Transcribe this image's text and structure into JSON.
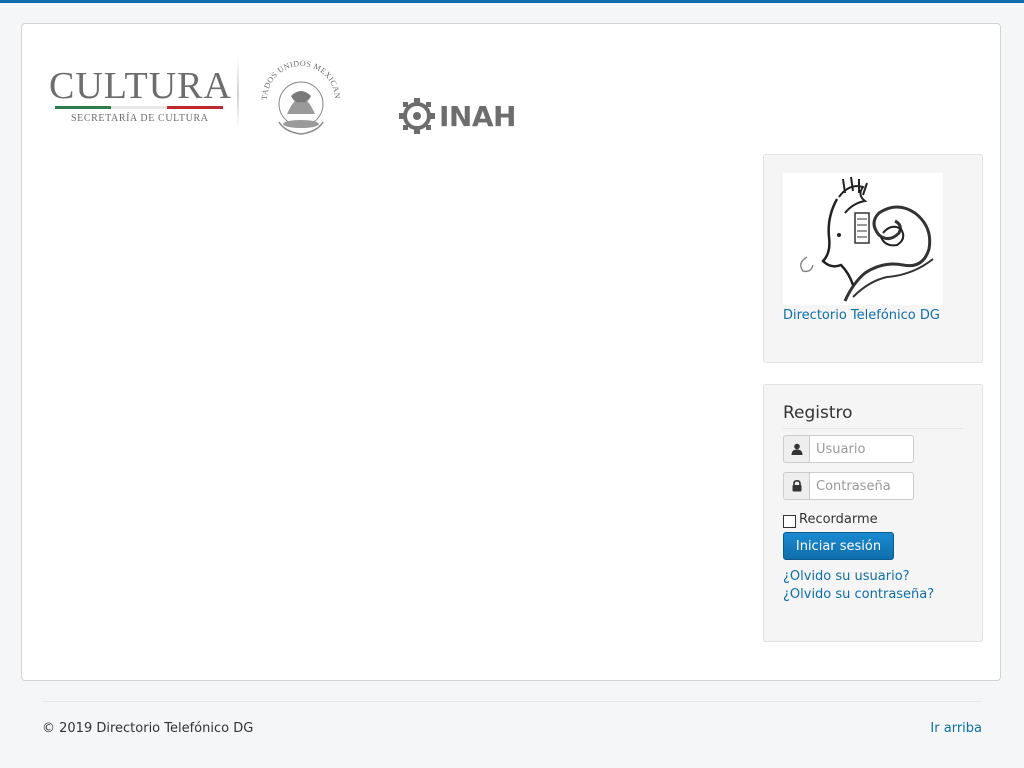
{
  "header": {
    "cultura_logo_word": "CULTURA",
    "cultura_logo_sub": "SECRETARÍA DE CULTURA",
    "seal_logo_text": "ESTADOS UNIDOS MEXICANOS",
    "inah_logo_text": "INAH",
    "flag_colors": [
      "#2e7d4f",
      "#ffffff",
      "#c0282d"
    ]
  },
  "sidebar": {
    "image_module": {
      "link_label": "Directorio Telefónico DG"
    },
    "login": {
      "title": "Registro",
      "username_placeholder": "Usuario",
      "password_placeholder": "Contraseña",
      "username_icon": "user-icon",
      "password_icon": "lock-icon",
      "remember_label": "Recordarme",
      "remember_checked": false,
      "submit_label": "Iniciar sesión",
      "forgot_username": "¿Olvido su usuario?",
      "forgot_password": "¿Olvido su contraseña?"
    }
  },
  "footer": {
    "copyright": "© 2019 Directorio Telefónico DG",
    "back_to_top": "Ir arriba"
  },
  "colors": {
    "accent": "#0f6eab",
    "top_bar": "#0f6eab"
  }
}
